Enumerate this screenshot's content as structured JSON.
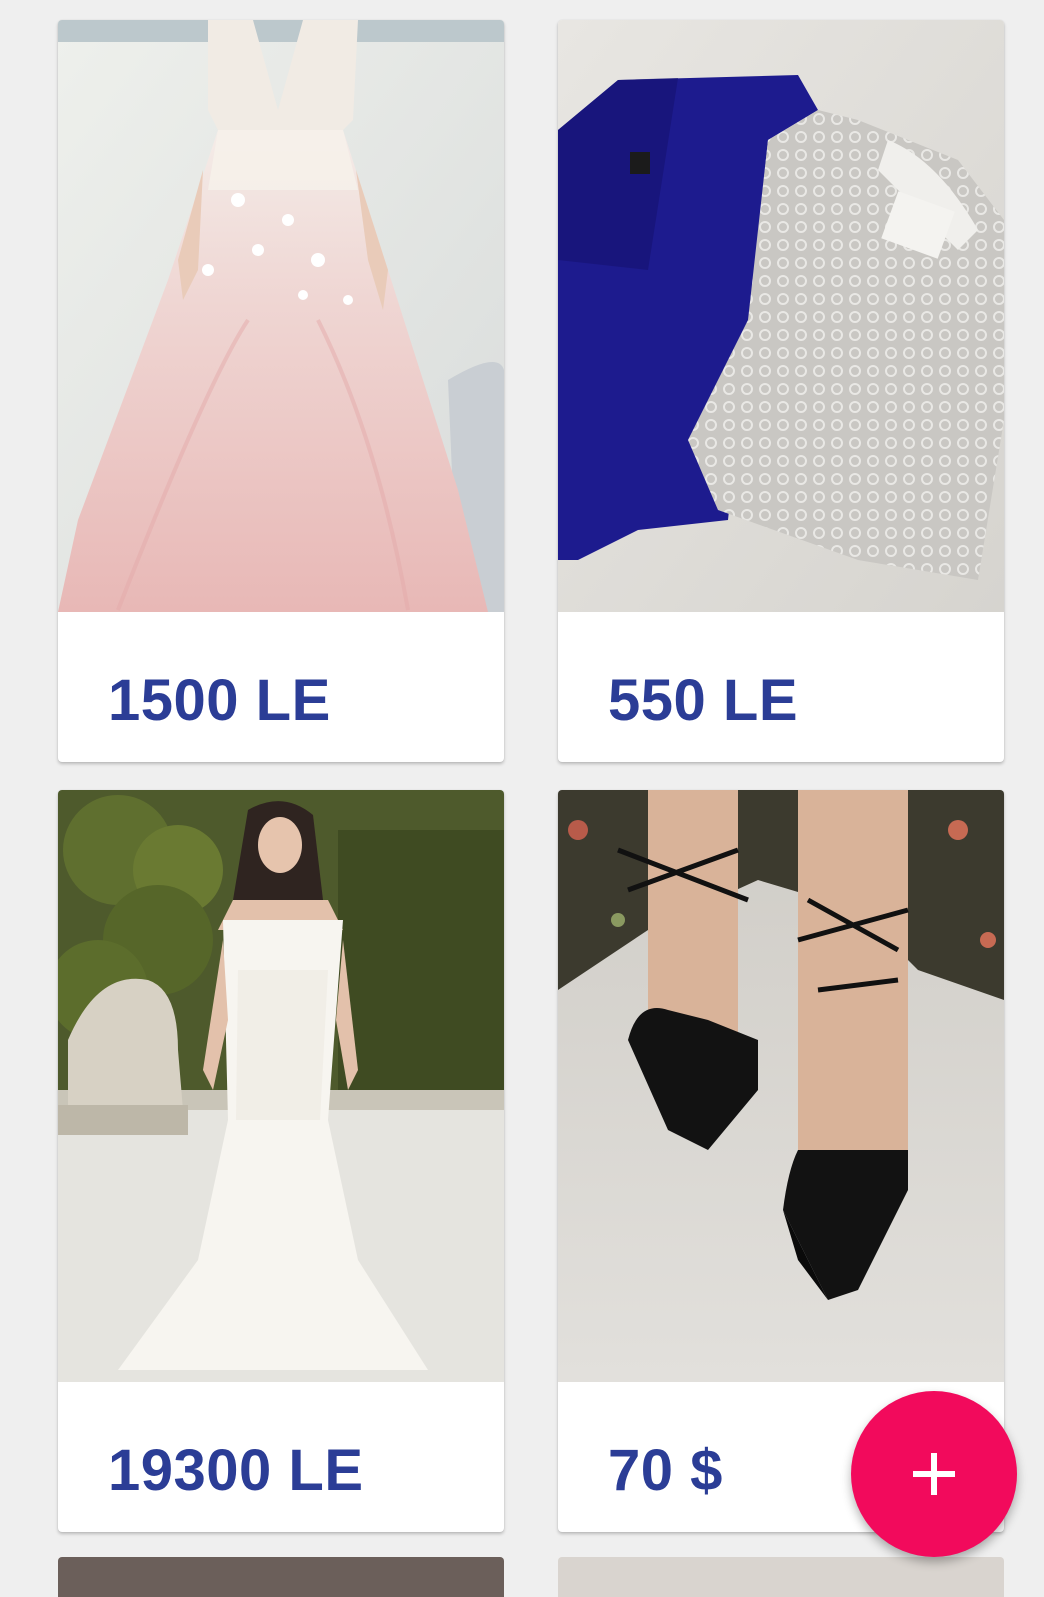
{
  "listings": [
    {
      "price": "1500 LE",
      "image_label": "pink lace ball gown"
    },
    {
      "price": "550 LE",
      "image_label": "navy and grey lace tops"
    },
    {
      "price": "19300 LE",
      "image_label": "white lace mermaid wedding dress"
    },
    {
      "price": "70 $",
      "image_label": "black lace-up pointed heels"
    }
  ],
  "fab": {
    "icon": "plus-icon"
  },
  "colors": {
    "price_text": "#2b3d96",
    "fab_background": "#f20a5c",
    "page_background": "#efefef",
    "card_background": "#ffffff"
  }
}
